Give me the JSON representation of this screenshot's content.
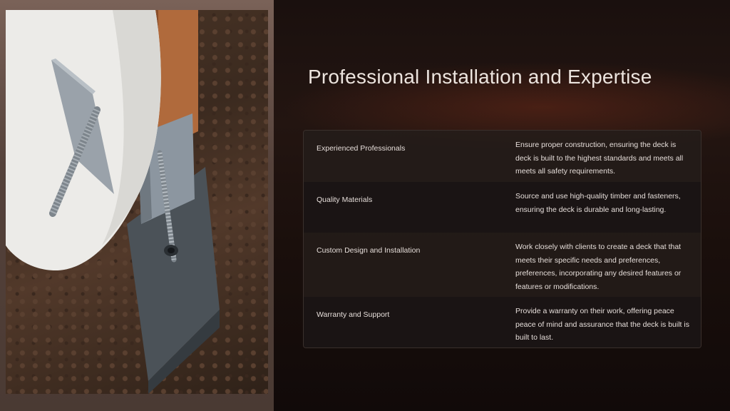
{
  "slide": {
    "title": "Professional Installation and Expertise",
    "accent": "#7a2d19"
  },
  "photo": {
    "subject": "metal post anchor with threaded bolt set into soil"
  },
  "table": {
    "rows": [
      {
        "label": "Experienced Professionals",
        "description": "Ensure proper construction, ensuring the deck is deck is built to the highest standards and meets all meets all safety requirements."
      },
      {
        "label": "Quality Materials",
        "description": "Source and use high-quality timber and fasteners, ensuring the deck is durable and long-lasting."
      },
      {
        "label": "Custom Design and Installation",
        "description": "Work closely with clients to create a deck that that meets their specific needs and preferences, preferences, incorporating any desired features or features or modifications."
      },
      {
        "label": "Warranty and Support",
        "description": "Provide a warranty on their work, offering peace peace of mind and assurance that the deck is built is built to last."
      }
    ]
  }
}
